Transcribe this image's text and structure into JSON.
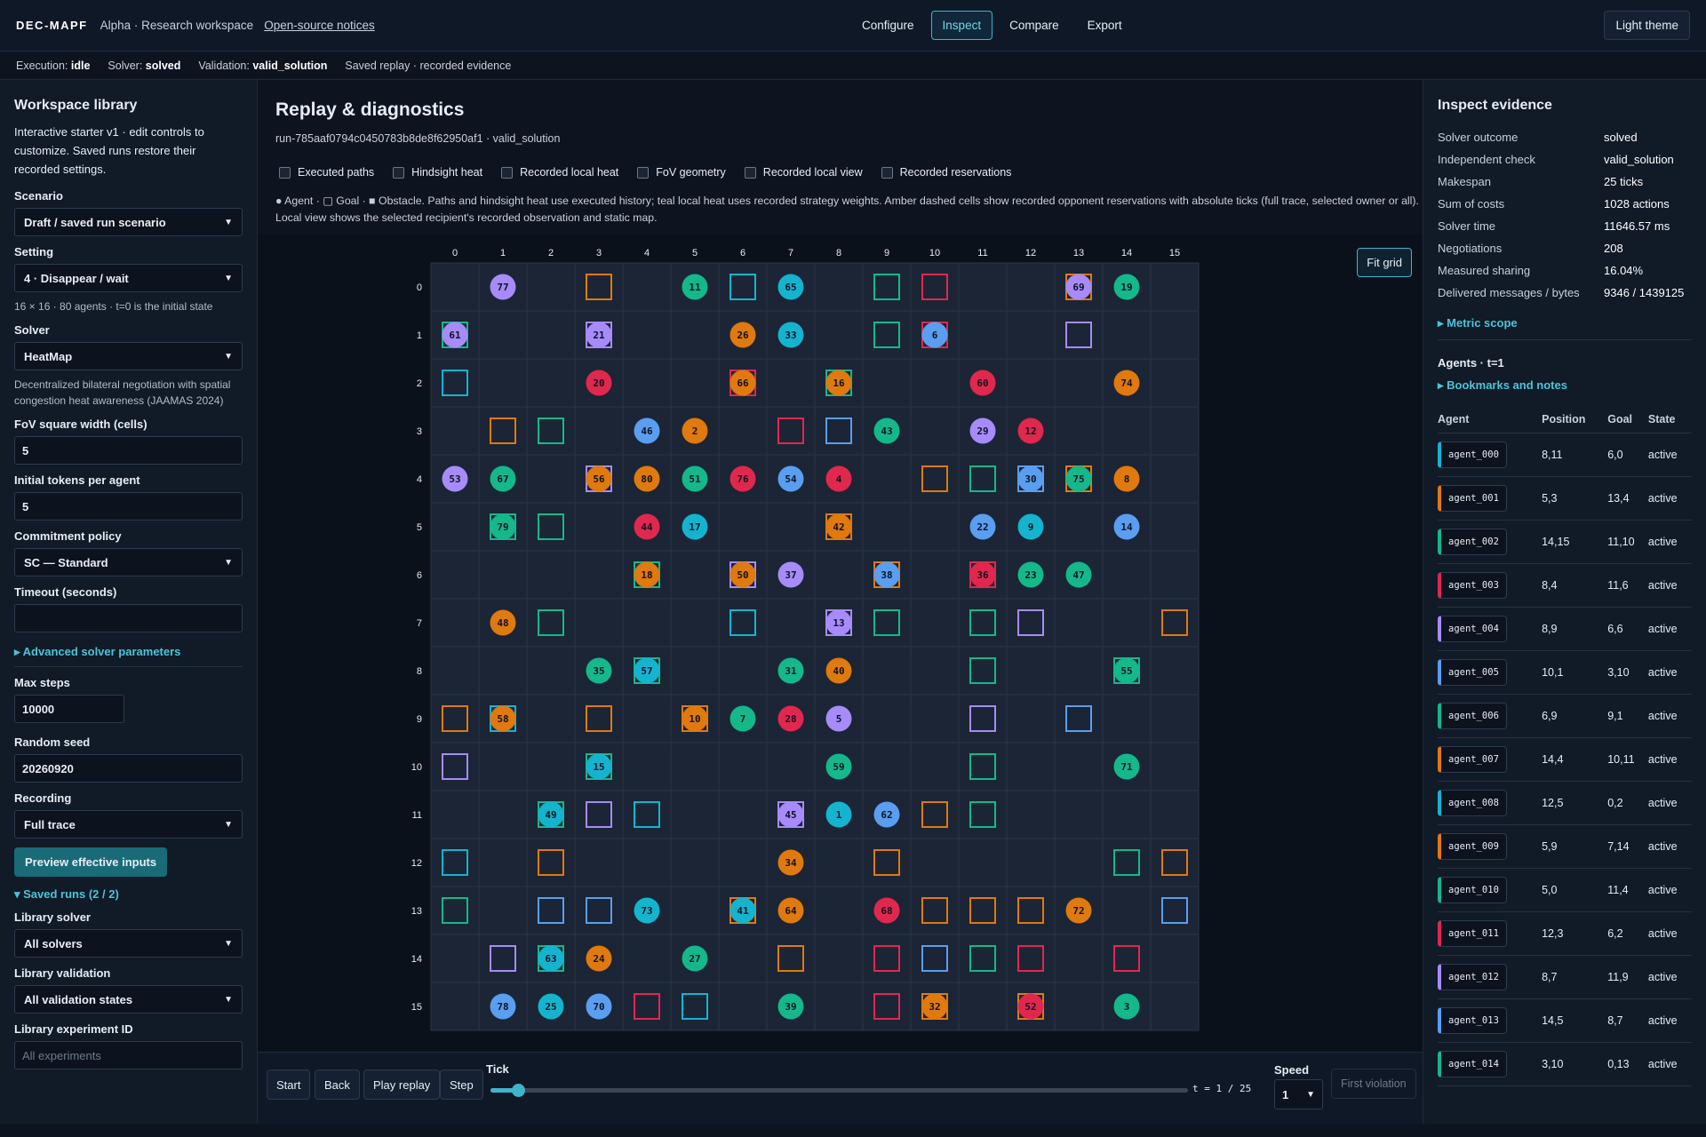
{
  "header": {
    "brand": "DEC-MAPF",
    "tagline": "Alpha · Research workspace",
    "notices": "Open-source notices",
    "nav": [
      "Configure",
      "Inspect",
      "Compare",
      "Export"
    ],
    "active_nav": "Inspect",
    "theme_button": "Light theme"
  },
  "status": {
    "execution_label": "Execution:",
    "execution": "idle",
    "solver_label": "Solver:",
    "solver": "solved",
    "validation_label": "Validation:",
    "validation": "valid_solution",
    "replay": "Saved replay · recorded evidence"
  },
  "left": {
    "title": "Workspace library",
    "description": "Interactive starter v1 · edit controls to customize. Saved runs restore their recorded settings.",
    "scenario_label": "Scenario",
    "scenario": "Draft / saved run scenario",
    "setting_label": "Setting",
    "setting": "4 · Disappear / wait",
    "setting_hint": "16 × 16 · 80 agents · t=0 is the initial state",
    "solver_label": "Solver",
    "solver": "HeatMap",
    "solver_hint": "Decentralized bilateral negotiation with spatial congestion heat awareness (JAAMAS 2024)",
    "fov_label": "FoV square width (cells)",
    "fov": "5",
    "tokens_label": "Initial tokens per agent",
    "tokens": "5",
    "commit_label": "Commitment policy",
    "commit": "SC — Standard",
    "timeout_label": "Timeout (seconds)",
    "timeout": "",
    "advanced": "▸ Advanced solver parameters",
    "maxsteps_label": "Max steps",
    "maxsteps": "10000",
    "seed_label": "Random seed",
    "seed": "20260920",
    "recording_label": "Recording",
    "recording": "Full trace",
    "preview_button": "Preview effective inputs",
    "saved_runs": "▾ Saved runs (2 / 2)",
    "lib_solver_label": "Library solver",
    "lib_solver": "All solvers",
    "lib_validation_label": "Library validation",
    "lib_validation": "All validation states",
    "lib_exp_label": "Library experiment ID",
    "lib_exp_placeholder": "All experiments"
  },
  "center": {
    "title": "Replay & diagnostics",
    "run_id": "run-785aaf0794c0450783b8de8f62950af1 · valid_solution",
    "toggles": [
      "Executed paths",
      "Hindsight heat",
      "Recorded local heat",
      "FoV geometry",
      "Recorded local view",
      "Recorded reservations"
    ],
    "legend": "● Agent · ▢ Goal · ■ Obstacle. Paths and hindsight heat use executed history; teal local heat uses recorded strategy weights. Amber dashed cells show recorded opponent reservations with absolute ticks (full trace, selected owner or all). Local view shows the selected recipient's recorded observation and static map.",
    "fit_button": "Fit grid"
  },
  "grid": {
    "cols": 16,
    "rows": 16,
    "palette": {
      "purple": "#a78bfa",
      "green": "#14b88a",
      "orange": "#e0790e",
      "cyan": "#14b4cf",
      "blue": "#5a9ef0",
      "red": "#e0284e"
    },
    "agents": [
      [
        1,
        0,
        77,
        "purple"
      ],
      [
        5,
        0,
        11,
        "green"
      ],
      [
        7,
        0,
        65,
        "cyan"
      ],
      [
        13,
        0,
        69,
        "purple"
      ],
      [
        14,
        0,
        19,
        "green"
      ],
      [
        0,
        1,
        61,
        "purple"
      ],
      [
        3,
        1,
        21,
        "purple"
      ],
      [
        6,
        1,
        26,
        "orange"
      ],
      [
        7,
        1,
        33,
        "cyan"
      ],
      [
        10,
        1,
        6,
        "blue"
      ],
      [
        3,
        2,
        20,
        "red"
      ],
      [
        6,
        2,
        66,
        "orange"
      ],
      [
        8,
        2,
        16,
        "orange"
      ],
      [
        11,
        2,
        60,
        "red"
      ],
      [
        14,
        2,
        74,
        "orange"
      ],
      [
        4,
        3,
        46,
        "blue"
      ],
      [
        5,
        3,
        2,
        "orange"
      ],
      [
        9,
        3,
        43,
        "green"
      ],
      [
        11,
        3,
        29,
        "purple"
      ],
      [
        12,
        3,
        12,
        "red"
      ],
      [
        0,
        4,
        53,
        "purple"
      ],
      [
        1,
        4,
        67,
        "green"
      ],
      [
        3,
        4,
        56,
        "orange"
      ],
      [
        4,
        4,
        80,
        "orange"
      ],
      [
        5,
        4,
        51,
        "green"
      ],
      [
        6,
        4,
        76,
        "red"
      ],
      [
        7,
        4,
        54,
        "blue"
      ],
      [
        8,
        4,
        4,
        "red"
      ],
      [
        12,
        4,
        30,
        "blue"
      ],
      [
        13,
        4,
        75,
        "green"
      ],
      [
        14,
        4,
        8,
        "orange"
      ],
      [
        1,
        5,
        79,
        "green"
      ],
      [
        4,
        5,
        44,
        "red"
      ],
      [
        5,
        5,
        17,
        "cyan"
      ],
      [
        8,
        5,
        42,
        "orange"
      ],
      [
        11,
        5,
        22,
        "blue"
      ],
      [
        12,
        5,
        9,
        "cyan"
      ],
      [
        14,
        5,
        14,
        "blue"
      ],
      [
        4,
        6,
        18,
        "orange"
      ],
      [
        6,
        6,
        50,
        "orange"
      ],
      [
        7,
        6,
        37,
        "purple"
      ],
      [
        9,
        6,
        38,
        "blue"
      ],
      [
        11,
        6,
        36,
        "red"
      ],
      [
        12,
        6,
        23,
        "green"
      ],
      [
        13,
        6,
        47,
        "green"
      ],
      [
        1,
        7,
        48,
        "orange"
      ],
      [
        8,
        7,
        13,
        "purple"
      ],
      [
        3,
        8,
        35,
        "green"
      ],
      [
        4,
        8,
        57,
        "cyan"
      ],
      [
        7,
        8,
        31,
        "green"
      ],
      [
        8,
        8,
        40,
        "orange"
      ],
      [
        14,
        8,
        55,
        "green"
      ],
      [
        1,
        9,
        58,
        "orange"
      ],
      [
        5,
        9,
        10,
        "orange"
      ],
      [
        6,
        9,
        7,
        "green"
      ],
      [
        7,
        9,
        28,
        "red"
      ],
      [
        8,
        9,
        5,
        "purple"
      ],
      [
        3,
        10,
        15,
        "cyan"
      ],
      [
        8,
        10,
        59,
        "green"
      ],
      [
        14,
        10,
        71,
        "green"
      ],
      [
        2,
        11,
        49,
        "cyan"
      ],
      [
        7,
        11,
        45,
        "purple"
      ],
      [
        8,
        11,
        1,
        "cyan"
      ],
      [
        9,
        11,
        62,
        "blue"
      ],
      [
        7,
        12,
        34,
        "orange"
      ],
      [
        4,
        13,
        73,
        "cyan"
      ],
      [
        6,
        13,
        41,
        "cyan"
      ],
      [
        7,
        13,
        64,
        "orange"
      ],
      [
        9,
        13,
        68,
        "red"
      ],
      [
        13,
        13,
        72,
        "orange"
      ],
      [
        2,
        14,
        63,
        "cyan"
      ],
      [
        3,
        14,
        24,
        "orange"
      ],
      [
        5,
        14,
        27,
        "green"
      ],
      [
        1,
        15,
        78,
        "blue"
      ],
      [
        2,
        15,
        25,
        "cyan"
      ],
      [
        3,
        15,
        70,
        "blue"
      ],
      [
        7,
        15,
        39,
        "green"
      ],
      [
        10,
        15,
        32,
        "orange"
      ],
      [
        12,
        15,
        52,
        "red"
      ],
      [
        14,
        15,
        3,
        "green"
      ]
    ],
    "goals": [
      [
        3,
        0,
        "orange"
      ],
      [
        6,
        0,
        "cyan"
      ],
      [
        9,
        0,
        "green"
      ],
      [
        10,
        0,
        "red"
      ],
      [
        13,
        0,
        "orange"
      ],
      [
        0,
        1,
        "green"
      ],
      [
        3,
        1,
        "purple"
      ],
      [
        9,
        1,
        "green"
      ],
      [
        10,
        1,
        "red"
      ],
      [
        13,
        1,
        "purple"
      ],
      [
        0,
        2,
        "cyan"
      ],
      [
        6,
        2,
        "red"
      ],
      [
        8,
        2,
        "green"
      ],
      [
        1,
        3,
        "orange"
      ],
      [
        2,
        3,
        "green"
      ],
      [
        7,
        3,
        "red"
      ],
      [
        8,
        3,
        "blue"
      ],
      [
        3,
        4,
        "purple"
      ],
      [
        10,
        4,
        "orange"
      ],
      [
        11,
        4,
        "green"
      ],
      [
        12,
        4,
        "blue"
      ],
      [
        13,
        4,
        "orange"
      ],
      [
        1,
        5,
        "green"
      ],
      [
        2,
        5,
        "green"
      ],
      [
        8,
        5,
        "orange"
      ],
      [
        4,
        6,
        "green"
      ],
      [
        6,
        6,
        "purple"
      ],
      [
        9,
        6,
        "orange"
      ],
      [
        11,
        6,
        "red"
      ],
      [
        2,
        7,
        "green"
      ],
      [
        6,
        7,
        "cyan"
      ],
      [
        8,
        7,
        "purple"
      ],
      [
        9,
        7,
        "green"
      ],
      [
        11,
        7,
        "green"
      ],
      [
        12,
        7,
        "purple"
      ],
      [
        15,
        7,
        "orange"
      ],
      [
        4,
        8,
        "green"
      ],
      [
        11,
        8,
        "green"
      ],
      [
        14,
        8,
        "green"
      ],
      [
        0,
        9,
        "orange"
      ],
      [
        1,
        9,
        "cyan"
      ],
      [
        3,
        9,
        "orange"
      ],
      [
        5,
        9,
        "orange"
      ],
      [
        11,
        9,
        "purple"
      ],
      [
        13,
        9,
        "blue"
      ],
      [
        0,
        10,
        "purple"
      ],
      [
        3,
        10,
        "green"
      ],
      [
        11,
        10,
        "green"
      ],
      [
        2,
        11,
        "green"
      ],
      [
        3,
        11,
        "purple"
      ],
      [
        4,
        11,
        "cyan"
      ],
      [
        7,
        11,
        "purple"
      ],
      [
        10,
        11,
        "orange"
      ],
      [
        11,
        11,
        "green"
      ],
      [
        0,
        12,
        "cyan"
      ],
      [
        2,
        12,
        "orange"
      ],
      [
        9,
        12,
        "orange"
      ],
      [
        14,
        12,
        "green"
      ],
      [
        15,
        12,
        "orange"
      ],
      [
        0,
        13,
        "green"
      ],
      [
        2,
        13,
        "blue"
      ],
      [
        3,
        13,
        "blue"
      ],
      [
        6,
        13,
        "orange"
      ],
      [
        10,
        13,
        "orange"
      ],
      [
        11,
        13,
        "orange"
      ],
      [
        12,
        13,
        "orange"
      ],
      [
        15,
        13,
        "blue"
      ],
      [
        1,
        14,
        "purple"
      ],
      [
        2,
        14,
        "green"
      ],
      [
        7,
        14,
        "orange"
      ],
      [
        9,
        14,
        "red"
      ],
      [
        10,
        14,
        "blue"
      ],
      [
        11,
        14,
        "green"
      ],
      [
        12,
        14,
        "red"
      ],
      [
        14,
        14,
        "red"
      ],
      [
        4,
        15,
        "red"
      ],
      [
        5,
        15,
        "cyan"
      ],
      [
        9,
        15,
        "red"
      ],
      [
        10,
        15,
        "orange"
      ],
      [
        12,
        15,
        "orange"
      ]
    ]
  },
  "bottom": {
    "buttons": [
      "Start",
      "Back",
      "Play replay",
      "Step"
    ],
    "tick_label": "Tick",
    "tick": 1,
    "tick_max": 25,
    "tick_readout": "t = 1 / 25",
    "speed_label": "Speed",
    "speed": "1",
    "first_violation": "First violation"
  },
  "right": {
    "title": "Inspect evidence",
    "metrics": [
      [
        "Solver outcome",
        "solved"
      ],
      [
        "Independent check",
        "valid_solution"
      ],
      [
        "Makespan",
        "25 ticks"
      ],
      [
        "Sum of costs",
        "1028 actions"
      ],
      [
        "Solver time",
        "11646.57 ms"
      ],
      [
        "Negotiations",
        "208"
      ],
      [
        "Measured sharing",
        "16.04%"
      ],
      [
        "Delivered messages / bytes",
        "9346 / 1439125"
      ]
    ],
    "metric_scope": "▸ Metric scope",
    "agents_heading": "Agents · t=1",
    "bookmarks": "▸ Bookmarks and notes",
    "table_headers": [
      "Agent",
      "Position",
      "Goal",
      "State"
    ],
    "agents": [
      [
        "agent_000",
        "8,11",
        "6,0",
        "active",
        "cyan"
      ],
      [
        "agent_001",
        "5,3",
        "13,4",
        "active",
        "orange"
      ],
      [
        "agent_002",
        "14,15",
        "11,10",
        "active",
        "green"
      ],
      [
        "agent_003",
        "8,4",
        "11,6",
        "active",
        "red"
      ],
      [
        "agent_004",
        "8,9",
        "6,6",
        "active",
        "purple"
      ],
      [
        "agent_005",
        "10,1",
        "3,10",
        "active",
        "blue"
      ],
      [
        "agent_006",
        "6,9",
        "9,1",
        "active",
        "green"
      ],
      [
        "agent_007",
        "14,4",
        "10,11",
        "active",
        "orange"
      ],
      [
        "agent_008",
        "12,5",
        "0,2",
        "active",
        "cyan"
      ],
      [
        "agent_009",
        "5,9",
        "7,14",
        "active",
        "orange"
      ],
      [
        "agent_010",
        "5,0",
        "11,4",
        "active",
        "green"
      ],
      [
        "agent_011",
        "12,3",
        "6,2",
        "active",
        "red"
      ],
      [
        "agent_012",
        "8,7",
        "11,9",
        "active",
        "purple"
      ],
      [
        "agent_013",
        "14,5",
        "8,7",
        "active",
        "blue"
      ],
      [
        "agent_014",
        "3,10",
        "0,13",
        "active",
        "green"
      ]
    ]
  }
}
